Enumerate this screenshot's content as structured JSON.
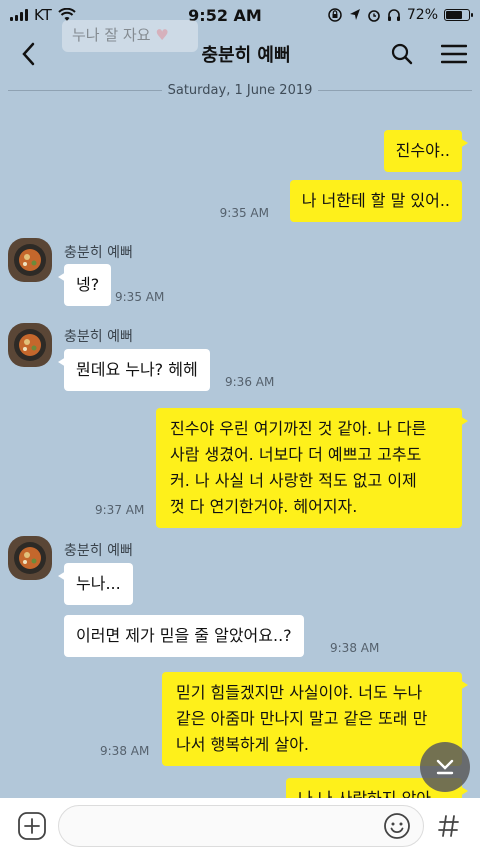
{
  "status": {
    "carrier": "KT",
    "time": "9:52 AM",
    "battery_percent": "72%",
    "battery_level": 0.72
  },
  "notification": {
    "text": "누나 잘 자요"
  },
  "header": {
    "title": "충분히 예뻐"
  },
  "chat": {
    "date": "Saturday, 1 June 2019",
    "contact_name": "충분히 예뻐",
    "messages": [
      {
        "from": "me",
        "text": "진수야.."
      },
      {
        "from": "me",
        "text": "나 너한테 할 말 있어..",
        "time": "9:35 AM"
      },
      {
        "from": "them",
        "text": "넹?",
        "time": "9:35 AM"
      },
      {
        "from": "them",
        "text": "뭔데요 누나? 헤헤",
        "time": "9:36 AM"
      },
      {
        "from": "me",
        "text": "진수야 우린 여기까진 것 같아. 나 다른 사람 생겼어. 너보다 더 예쁘고 고추도 커. 나 사실 너 사랑한 적도 없고 이제 껏 다 연기한거야. 헤어지자.",
        "lines": [
          "진수야 우린 여기까진 것 같아. 나 다른",
          "사람 생겼어. 너보다 더 예쁘고 고추도",
          "커. 나 사실 너 사랑한 적도 없고 이제",
          "껏 다 연기한거야. 헤어지자."
        ],
        "time": "9:37 AM"
      },
      {
        "from": "them",
        "text": "누나...",
        "time": ""
      },
      {
        "from": "them",
        "text": "이러면 제가 믿을 줄 알았어요..?",
        "time": "9:38 AM"
      },
      {
        "from": "me",
        "text": "믿기 힘들겠지만 사실이야. 너도 누나 같은 아줌마 만나지 말고 같은 또래 만나서 행복하게 살아.",
        "lines": [
          "믿기 힘들겠지만 사실이야. 너도 누나",
          "같은 아줌마 만나지 말고 같은 또래 만",
          "나서 행복하게 살아."
        ],
        "time": "9:38 AM"
      },
      {
        "from": "me",
        "text": "나 나 사랑하지 않아",
        "partial": true
      }
    ]
  },
  "input": {
    "placeholder": ""
  },
  "icons": {
    "back": "chevron-left-icon",
    "search": "search-icon",
    "menu": "hamburger-menu-icon",
    "add": "plus-icon",
    "emoji": "smiley-icon",
    "hashtag": "hash-icon",
    "scroll": "chevron-down-icon"
  },
  "colors": {
    "background": "#b2c7d9",
    "my_bubble": "#fef01b",
    "their_bubble": "#ffffff"
  }
}
